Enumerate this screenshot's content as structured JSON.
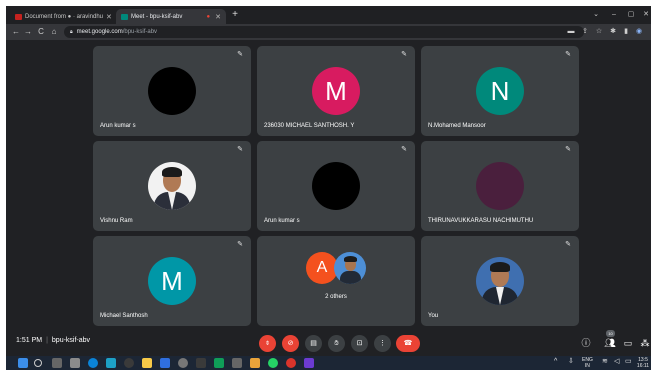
{
  "browser": {
    "tabs": [
      {
        "title": "Document from ● · aravindhu",
        "active": false,
        "favicon_color": "#c5221f"
      },
      {
        "title": "Meet - bpu-ksif-abv",
        "active": true,
        "favicon_color": "#00897b"
      }
    ],
    "url": {
      "host": "meet.google.com",
      "path": "/bpu-ksif-abv"
    }
  },
  "meeting": {
    "time": "1:51 PM",
    "code": "bpu-ksif-abv",
    "participant_count": "10",
    "tiles": [
      {
        "name": "Arun kumar s",
        "avatar_type": "dark-circle"
      },
      {
        "name": "236030 MICHAEL SANTHOSH. Y",
        "avatar_type": "letter",
        "letter": "M",
        "color": "#d81b60"
      },
      {
        "name": "N.Mohamed Mansoor",
        "avatar_type": "letter",
        "letter": "N",
        "color": "#00897b"
      },
      {
        "name": "Vishnu Ram",
        "avatar_type": "photo"
      },
      {
        "name": "Arun kumar s",
        "avatar_type": "dark-circle"
      },
      {
        "name": "THIRUNAVUKKARASU NACHIMUTHU",
        "avatar_type": "logo"
      },
      {
        "name": "Michael Santhosh",
        "avatar_type": "letter",
        "letter": "M",
        "color": "#0097a7"
      },
      {
        "name": "",
        "avatar_type": "group",
        "others_label": "2 others",
        "mini_letter": "A",
        "mini_color": "#f4511e"
      },
      {
        "name": "You",
        "avatar_type": "photo"
      }
    ]
  },
  "colors": {
    "meet_bg": "#202124",
    "tile_bg": "#3c4043",
    "end_call": "#ea4335"
  }
}
